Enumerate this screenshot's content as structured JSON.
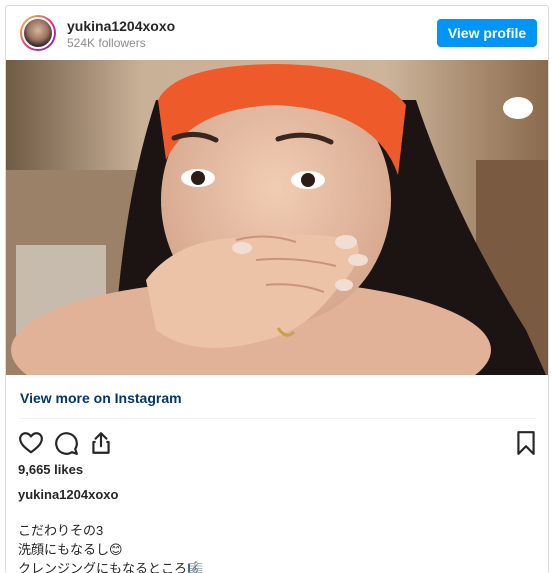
{
  "header": {
    "username": "yukina1204xoxo",
    "followers": "524K followers",
    "view_profile_label": "View profile"
  },
  "post": {
    "view_more_label": "View more on Instagram",
    "likes": "9,665 likes",
    "caption_user": "yukina1204xoxo",
    "caption_lines": [
      "こだわりその3",
      "洗顔にもなるし😊",
      "クレンジングにもなるところ🎼"
    ]
  },
  "icons": {
    "like": "heart-icon",
    "comment": "comment-icon",
    "share": "share-icon",
    "save": "bookmark-icon"
  },
  "colors": {
    "button": "#0095f6",
    "link": "#00376b",
    "headband": "#ef5a2a"
  }
}
